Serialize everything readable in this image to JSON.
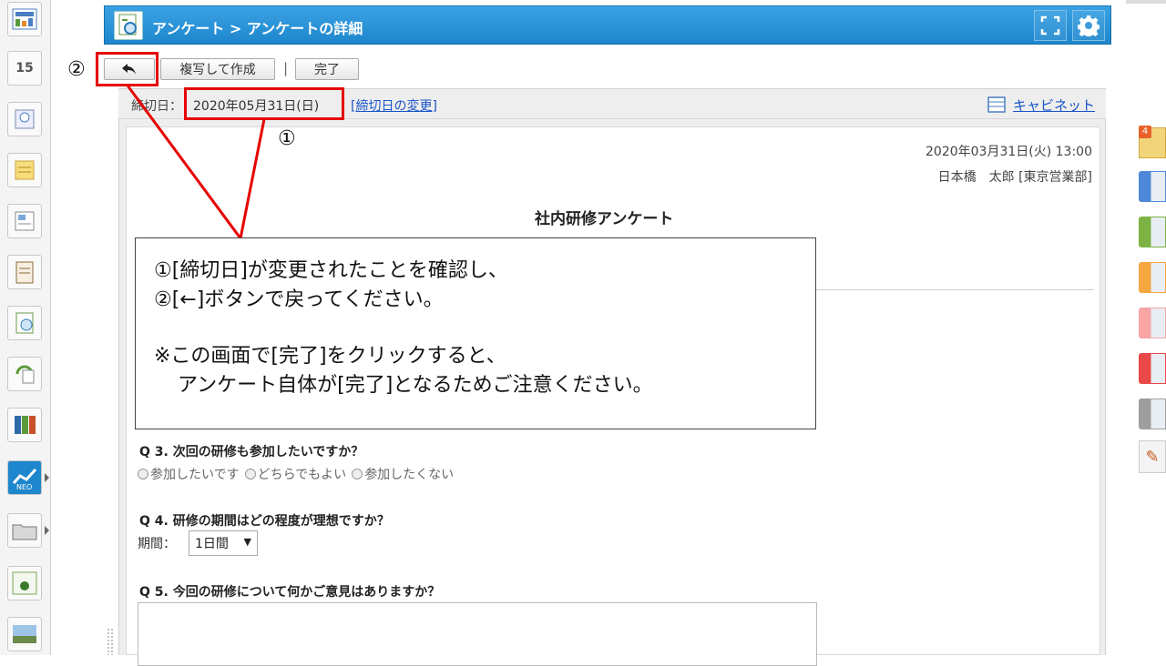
{
  "header": {
    "title": "アンケート > アンケートの詳細"
  },
  "toolbar": {
    "back_label": "←",
    "copy_create_label": "複写して作成",
    "separator": "|",
    "complete_label": "完了"
  },
  "info_bar": {
    "deadline_label": "締切日：",
    "deadline_value": "2020年05月31日(日)",
    "change_deadline_link": "[締切日の変更]",
    "cabinet_link": "キャビネット"
  },
  "document": {
    "date": "2020年03月31日(火) 13:00",
    "author": "日本橋　太郎 [東京営業部]",
    "title": "社内研修アンケート"
  },
  "questions": {
    "q3": {
      "text": "Q 3. 次回の研修も参加したいですか？",
      "options": [
        "参加したいです",
        "どちらでもよい",
        "参加したくない"
      ]
    },
    "q4": {
      "text": "Q 4. 研修の期間はどの程度が理想ですか？",
      "period_label": "期間：",
      "selected": "1日間"
    },
    "q5": {
      "text": "Q 5. 今回の研修について何かご意見はありますか？"
    }
  },
  "annotations": {
    "marker_1": "①",
    "marker_2": "②",
    "callout_lines": [
      "①[締切日]が変更されたことを確認し、",
      "②[←]ボタンで戻ってください。",
      "※この画面で[完了]をクリックすると、",
      "アンケート自体が[完了]となるためご注意ください。"
    ]
  },
  "right_dock": {
    "badge_count": "4",
    "tab_colors": [
      "#4f88d8",
      "#7cb342",
      "#f5a742",
      "#f7a5a5",
      "#e84848",
      "#9e9e9e"
    ]
  },
  "left_sidebar": {
    "calendar_day": "15",
    "icons": [
      "dashboard-icon",
      "calendar-icon",
      "timecard-icon",
      "memo-icon",
      "bulletin-icon",
      "report-icon",
      "survey-icon",
      "workflow-icon",
      "cabinet-icon",
      "neo-icon",
      "folder-icon",
      "tanomail-icon",
      "photo-icon"
    ]
  }
}
